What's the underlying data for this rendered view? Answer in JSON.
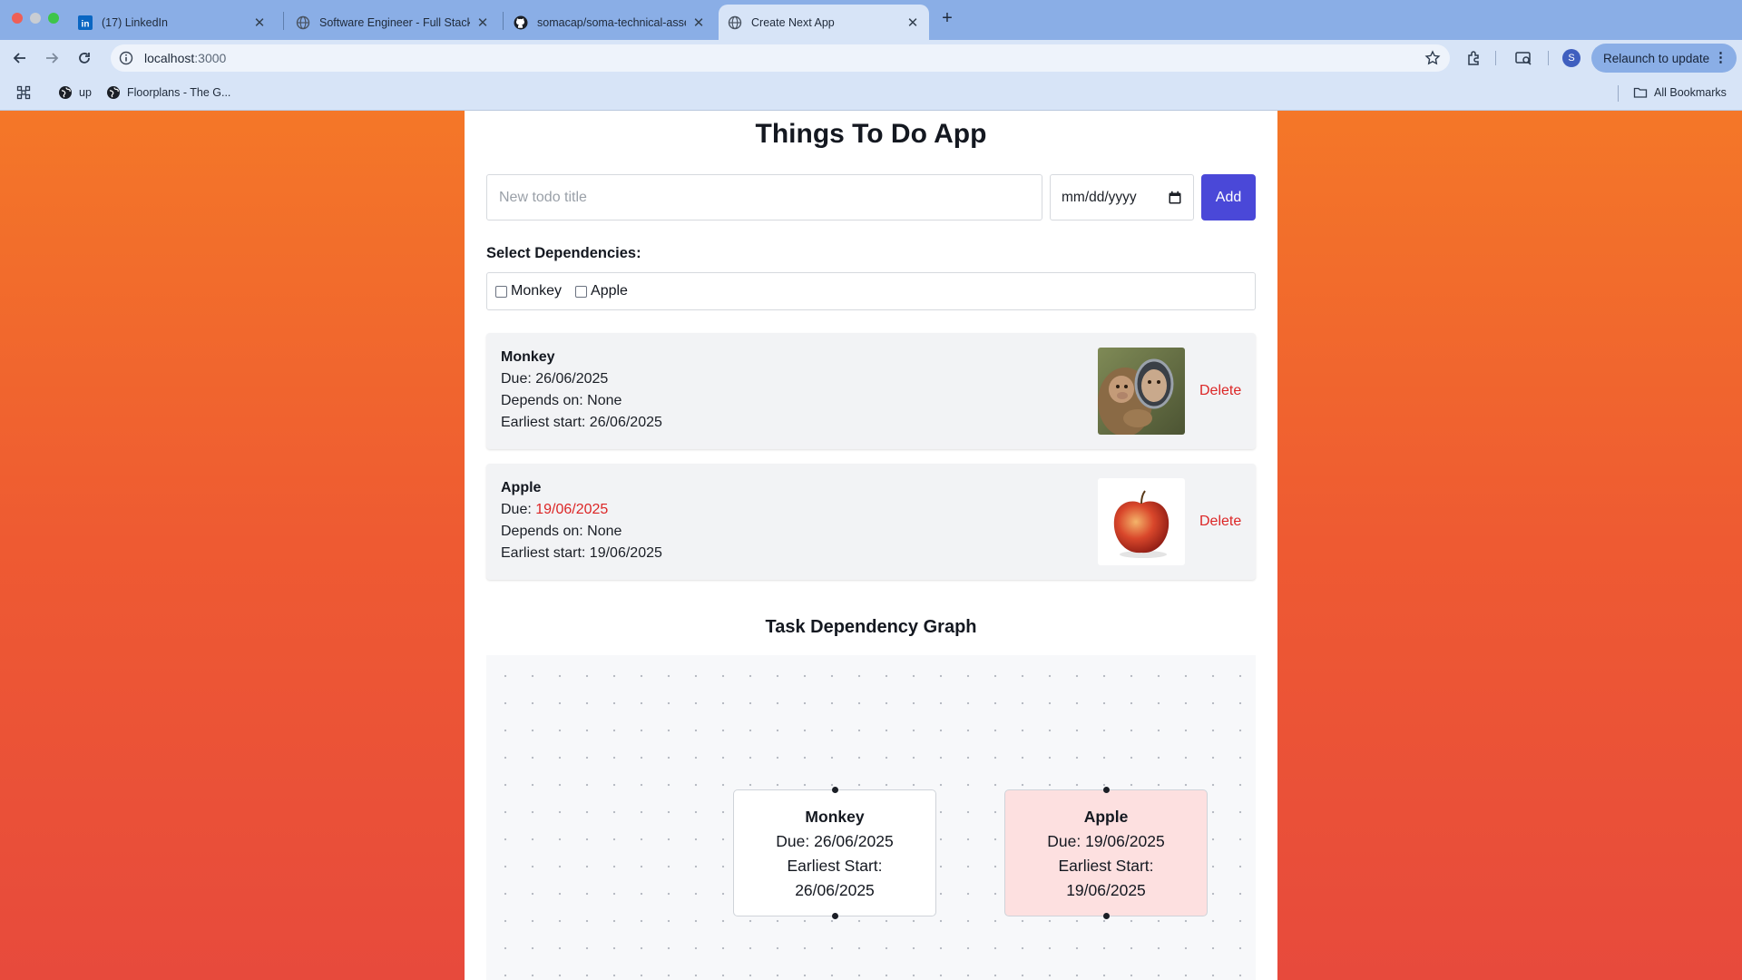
{
  "browser": {
    "tabs": [
      {
        "title": "(17) LinkedIn",
        "icon": "linkedin-icon"
      },
      {
        "title": "Software Engineer - Full Stack",
        "icon": "globe-icon"
      },
      {
        "title": "somacap/soma-technical-assessment",
        "icon": "github-icon"
      },
      {
        "title": "Create Next App",
        "icon": "globe-icon",
        "active": true
      }
    ],
    "url_host": "localhost",
    "url_port": ":3000",
    "profile_initial": "S",
    "relaunch_label": "Relaunch to update",
    "bookmarks": [
      {
        "label": "up"
      },
      {
        "label": "Floorplans - The G..."
      }
    ],
    "all_bookmarks_label": "All Bookmarks"
  },
  "app": {
    "title": "Things To Do App",
    "title_placeholder": "New todo title",
    "date_placeholder": "mm/dd/yyyy",
    "add_label": "Add",
    "deps_label": "Select Dependencies:",
    "dependency_options": [
      "Monkey",
      "Apple"
    ],
    "todos": [
      {
        "name": "Monkey",
        "due_prefix": "Due: ",
        "due": "26/06/2025",
        "overdue": false,
        "depends_on": "Depends on: None",
        "earliest_start": "Earliest start: 26/06/2025",
        "image": "monkey-photo",
        "delete_label": "Delete"
      },
      {
        "name": "Apple",
        "due_prefix": "Due: ",
        "due": "19/06/2025",
        "overdue": true,
        "depends_on": "Depends on: None",
        "earliest_start": "Earliest start: 19/06/2025",
        "image": "apple-photo",
        "delete_label": "Delete"
      }
    ],
    "graph": {
      "title": "Task Dependency Graph",
      "nodes": [
        {
          "name": "Monkey",
          "due": "Due: 26/06/2025",
          "earliest_label": "Earliest Start:",
          "earliest": "26/06/2025",
          "late": false
        },
        {
          "name": "Apple",
          "due": "Due: 19/06/2025",
          "earliest_label": "Earliest Start:",
          "earliest": "19/06/2025",
          "late": true
        }
      ]
    }
  },
  "colors": {
    "accent_button": "#4a48d8",
    "overdue_text": "#dc2626",
    "late_node_bg": "#fde0e0",
    "background_gradient_top": "#f47728",
    "background_gradient_bottom": "#e74a3c"
  }
}
